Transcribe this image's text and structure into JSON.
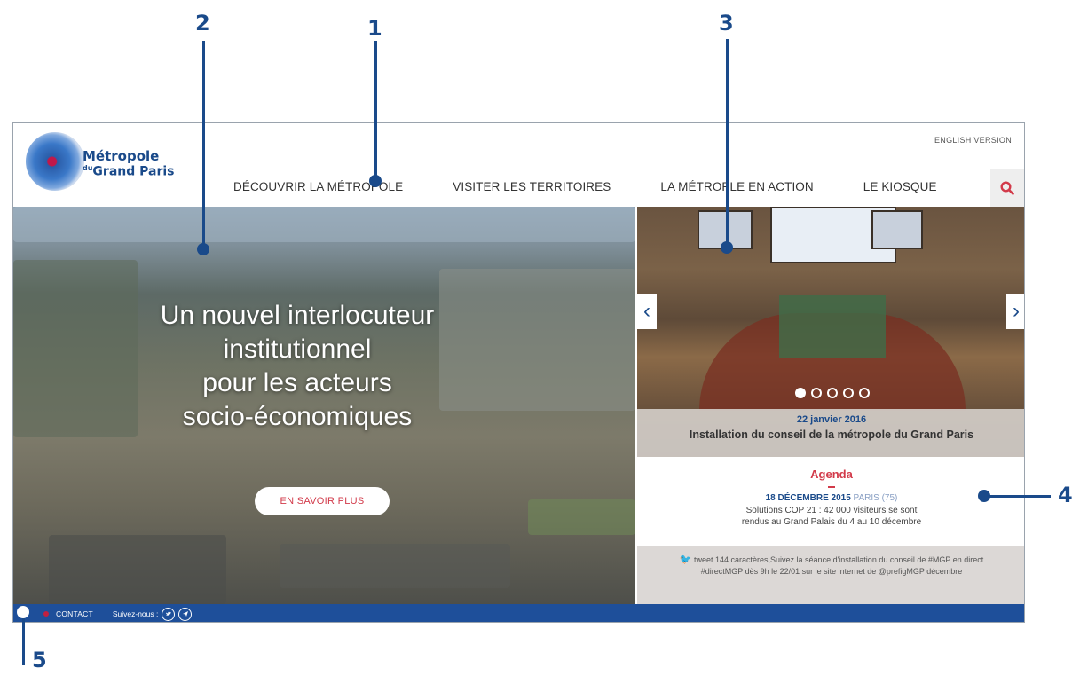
{
  "annotations": {
    "n1": "1",
    "n2": "2",
    "n3": "3",
    "n4": "4",
    "n5": "5"
  },
  "header": {
    "logo_line1": "Métropole",
    "logo_line2_prefix": "du",
    "logo_line2": "Grand Paris",
    "english": "ENGLISH VERSION",
    "nav": [
      {
        "label": "DÉCOUVRIR LA MÉTROPOLE"
      },
      {
        "label": "VISITER LES TERRITOIRES"
      },
      {
        "label": "LA MÉTROPLE EN ACTION"
      },
      {
        "label": "LE KIOSQUE"
      }
    ]
  },
  "hero": {
    "line1": "Un nouvel interlocuteur",
    "line2": "institutionnel",
    "line3": "pour les acteurs",
    "line4": "socio-économiques",
    "button": "EN SAVOIR PLUS"
  },
  "slider": {
    "date": "22 janvier 2016",
    "title": "Installation du conseil de la métropole du Grand Paris",
    "prev": "‹",
    "next": "›",
    "active_dot": 1
  },
  "agenda": {
    "title": "Agenda",
    "date": "18 DÉCEMBRE 2015",
    "location": "PARIS (75)",
    "line1": "Solutions COP 21 : 42 000 visiteurs se sont",
    "line2": "rendus au Grand Palais du 4 au 10 décembre"
  },
  "tweet": {
    "bird": "🐦",
    "text": "tweet 144 caractères,Suivez la séance d'installation du conseil de #MGP en direct #directMGP dès 9h le 22/01 sur le site internet de @prefigMGP décembre"
  },
  "footer": {
    "contact": "CONTACT",
    "follow": "Suivez-nous :"
  },
  "colors": {
    "brand_blue": "#1a4a8a",
    "accent_red": "#d23a4a",
    "footer_blue": "#1e4f9a"
  }
}
